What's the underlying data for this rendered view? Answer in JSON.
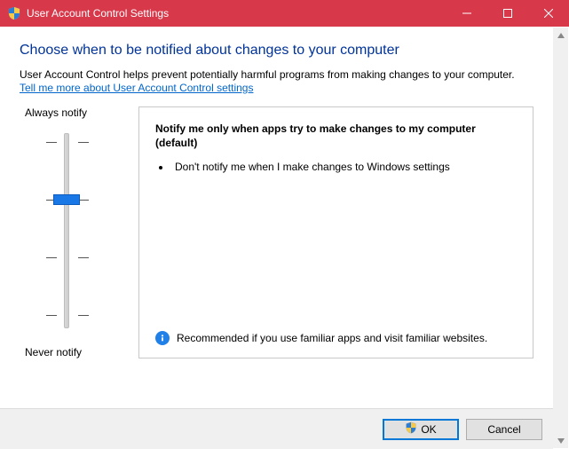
{
  "window": {
    "title": "User Account Control Settings"
  },
  "heading": "Choose when to be notified about changes to your computer",
  "description": "User Account Control helps prevent potentially harmful programs from making changes to your computer.",
  "help_link": "Tell me more about User Account Control settings",
  "slider": {
    "top_label": "Always notify",
    "bottom_label": "Never notify",
    "levels": 4,
    "current_level": 2
  },
  "panel": {
    "title": "Notify me only when apps try to make changes to my computer (default)",
    "bullets": [
      "Don't notify me when I make changes to Windows settings"
    ],
    "recommendation": "Recommended if you use familiar apps and visit familiar websites."
  },
  "buttons": {
    "ok": "OK",
    "cancel": "Cancel"
  }
}
